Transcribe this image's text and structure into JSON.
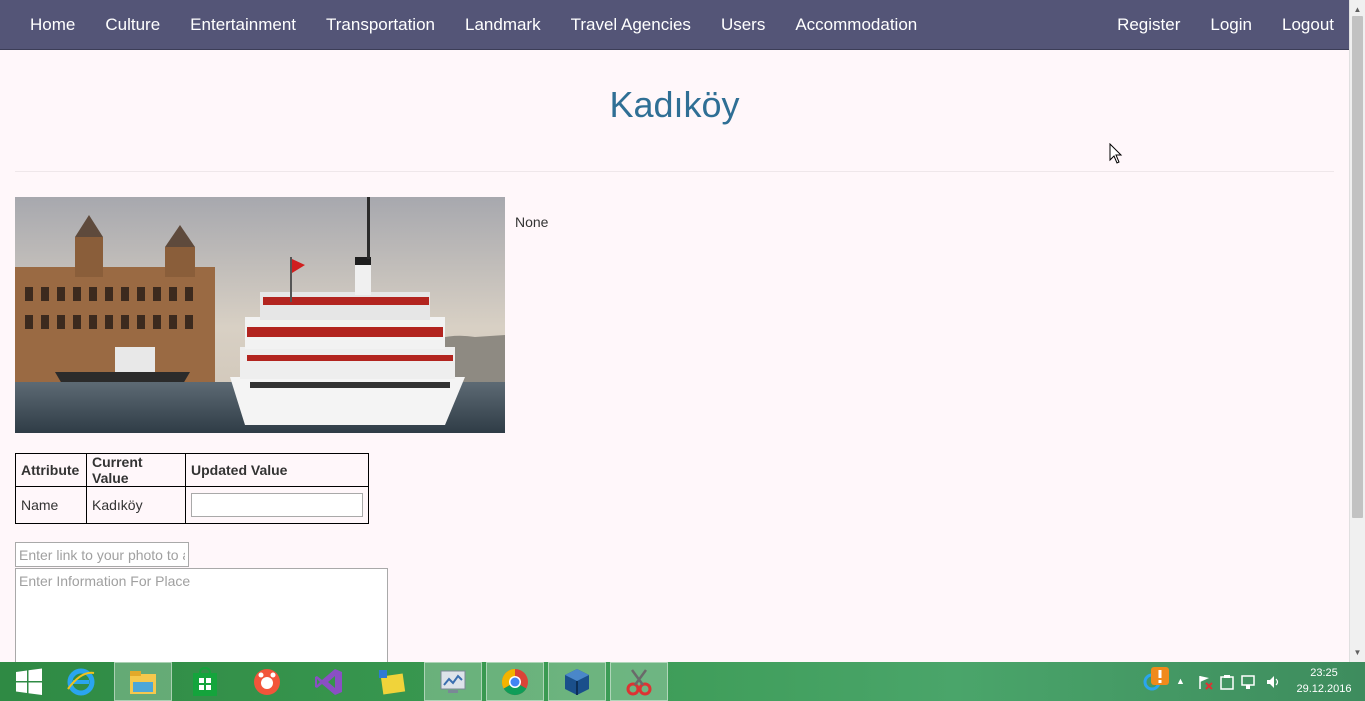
{
  "nav": {
    "left": [
      "Home",
      "Culture",
      "Entertainment",
      "Transportation",
      "Landmark",
      "Travel Agencies",
      "Users",
      "Accommodation"
    ],
    "right": [
      "Register",
      "Login",
      "Logout"
    ]
  },
  "page": {
    "title": "Kadıköy",
    "info": "None",
    "photo_icon": "ferry-photo"
  },
  "table": {
    "headers": [
      "Attribute",
      "Current Value",
      "Updated Value"
    ],
    "rows": [
      {
        "attribute": "Name",
        "current": "Kadıköy",
        "updated": ""
      }
    ]
  },
  "form": {
    "photo_link_placeholder": "Enter link to your photo to add",
    "info_placeholder": "Enter Information For Place"
  },
  "taskbar": {
    "apps": [
      "start-icon",
      "internet-explorer-icon",
      "file-explorer-icon",
      "store-icon",
      "app-orange-icon",
      "visual-studio-icon",
      "app-folder-icon",
      "app-monitor-icon",
      "chrome-icon",
      "virtualbox-icon",
      "snipping-tool-icon"
    ],
    "time": "23:25",
    "date": "29.12.2016"
  },
  "colors": {
    "navbar": "#545577",
    "title": "#2f6f95",
    "background": "#fff7fa",
    "taskbar": "#3a9a52"
  }
}
